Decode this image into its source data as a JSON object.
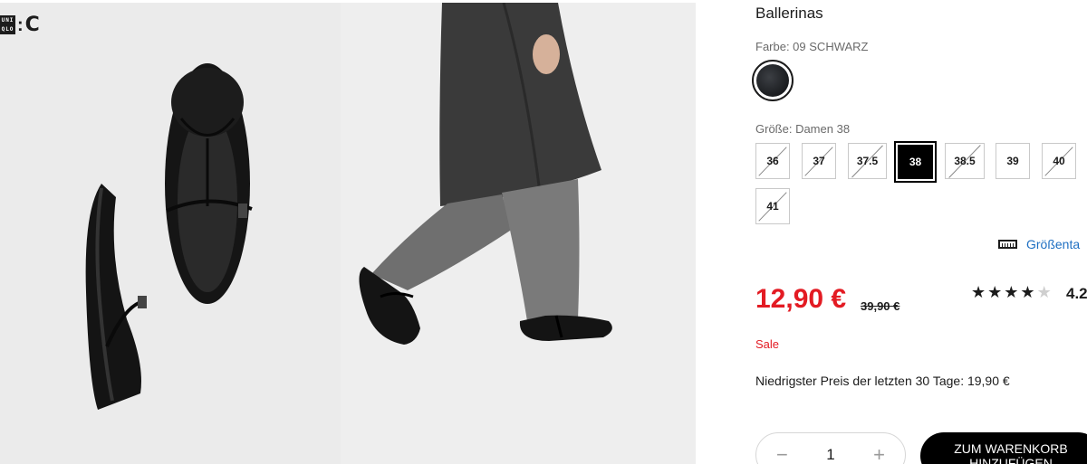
{
  "brand": {
    "logo_box": "UNI QLO",
    "logo_suffix": "C"
  },
  "product": {
    "title": "Ballerinas",
    "color_label": "Farbe: 09 SCHWARZ",
    "size_label": "Größe: Damen 38",
    "sizes": [
      {
        "label": "36",
        "available": false,
        "selected": false
      },
      {
        "label": "37",
        "available": false,
        "selected": false
      },
      {
        "label": "37.5",
        "available": false,
        "selected": false
      },
      {
        "label": "38",
        "available": true,
        "selected": true
      },
      {
        "label": "38.5",
        "available": false,
        "selected": false
      },
      {
        "label": "39",
        "available": true,
        "selected": false
      },
      {
        "label": "40",
        "available": false,
        "selected": false
      },
      {
        "label": "41",
        "available": false,
        "selected": false
      }
    ],
    "size_guide": "Größenta",
    "price": "12,90 €",
    "old_price": "39,90 €",
    "rating_stars_filled": 4,
    "rating": "4.2",
    "sale_label": "Sale",
    "lowest_price": "Niedrigster Preis der letzten 30 Tage: 19,90 €",
    "quantity": "1",
    "qty_minus": "−",
    "qty_plus": "+",
    "cart_button": "ZUM WARENKORB HINZUFÜGEN"
  },
  "colors": {
    "accent_red": "#e31b23",
    "link_blue": "#1e6fc2",
    "swatch": "#1a1c1f"
  }
}
